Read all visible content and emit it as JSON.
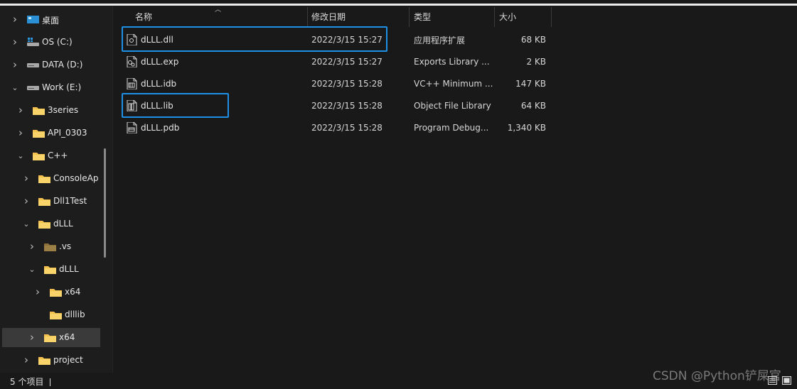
{
  "sidebar": {
    "items": [
      {
        "label": "桌面",
        "chevron": "right",
        "icon": "desktop-icon"
      },
      {
        "label": "OS (C:)",
        "chevron": "right",
        "icon": "windows-drive-icon"
      },
      {
        "label": "DATA (D:)",
        "chevron": "right",
        "icon": "drive-icon"
      },
      {
        "label": "Work (E:)",
        "chevron": "down",
        "icon": "drive-icon"
      },
      {
        "label": "3series",
        "chevron": "right",
        "icon": "folder-icon"
      },
      {
        "label": "API_0303",
        "chevron": "right",
        "icon": "folder-icon"
      },
      {
        "label": "C++",
        "chevron": "down",
        "icon": "folder-icon"
      },
      {
        "label": "ConsoleAp",
        "chevron": "right",
        "icon": "folder-icon"
      },
      {
        "label": "Dll1Test",
        "chevron": "right",
        "icon": "folder-icon"
      },
      {
        "label": "dLLL",
        "chevron": "down",
        "icon": "folder-icon"
      },
      {
        "label": ".vs",
        "chevron": "right",
        "icon": "hidden-folder-icon"
      },
      {
        "label": "dLLL",
        "chevron": "down",
        "icon": "folder-icon"
      },
      {
        "label": "x64",
        "chevron": "right",
        "icon": "folder-icon"
      },
      {
        "label": "dlllib",
        "chevron": "none",
        "icon": "folder-icon"
      },
      {
        "label": "x64",
        "chevron": "right",
        "icon": "folder-icon",
        "selected": true
      },
      {
        "label": "project",
        "chevron": "right",
        "icon": "folder-icon"
      }
    ]
  },
  "columns": {
    "name": "名称",
    "modified": "修改日期",
    "type": "类型",
    "size": "大小"
  },
  "files": [
    {
      "name": "dLLL.dll",
      "modified": "2022/3/15 15:27",
      "type": "应用程序扩展",
      "size": "68 KB",
      "icon": "dll-file-icon",
      "highlighted": true
    },
    {
      "name": "dLLL.exp",
      "modified": "2022/3/15 15:27",
      "type": "Exports Library ...",
      "size": "2 KB",
      "icon": "exp-file-icon",
      "highlighted": false
    },
    {
      "name": "dLLL.idb",
      "modified": "2022/3/15 15:28",
      "type": "VC++ Minimum ...",
      "size": "147 KB",
      "icon": "idb-file-icon",
      "highlighted": false
    },
    {
      "name": "dLLL.lib",
      "modified": "2022/3/15 15:28",
      "type": "Object File Library",
      "size": "64 KB",
      "icon": "lib-file-icon",
      "highlighted": true
    },
    {
      "name": "dLLL.pdb",
      "modified": "2022/3/15 15:28",
      "type": "Program Debug...",
      "size": "1,340 KB",
      "icon": "pdb-file-icon",
      "highlighted": false
    }
  ],
  "status": {
    "count": "5 个项目"
  },
  "watermark": "CSDN @Python铲屎官",
  "colors": {
    "background": "#191919",
    "highlight": "#1e90e6",
    "folder": "#f3c34d",
    "selected_row": "#3a3a3a"
  }
}
